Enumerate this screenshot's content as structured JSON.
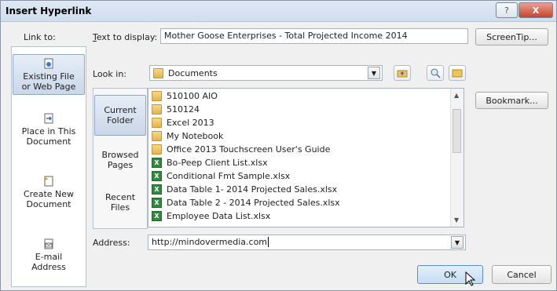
{
  "dialog": {
    "title": "Insert Hyperlink",
    "help_glyph": "?",
    "close_glyph": "X"
  },
  "link_to": {
    "label": "Link to:",
    "items": [
      {
        "line1": "Existing File",
        "line2": "or Web Page",
        "selected": true
      },
      {
        "line1": "Place in This",
        "line2": "Document"
      },
      {
        "line1": "Create New",
        "line2": "Document"
      },
      {
        "line1": "E-mail",
        "line2": "Address"
      }
    ]
  },
  "text_to_display": {
    "label": "Text to display:",
    "value": "Mother Goose Enterprises - Total Projected Income 2014"
  },
  "screentip_button": "ScreenTip...",
  "look_in": {
    "label": "Look in:",
    "value": "Documents"
  },
  "locations": [
    {
      "line1": "Current",
      "line2": "Folder",
      "selected": true
    },
    {
      "line1": "Browsed",
      "line2": "Pages"
    },
    {
      "line1": "Recent",
      "line2": "Files"
    }
  ],
  "files": [
    {
      "name": "510100 AIO",
      "type": "folder"
    },
    {
      "name": "510124",
      "type": "folder"
    },
    {
      "name": "Excel 2013",
      "type": "folder"
    },
    {
      "name": "My Notebook",
      "type": "folder"
    },
    {
      "name": "Office 2013 Touchscreen User's Guide",
      "type": "folder"
    },
    {
      "name": "Bo-Peep Client List.xlsx",
      "type": "excel"
    },
    {
      "name": "Conditional Fmt Sample.xlsx",
      "type": "excel"
    },
    {
      "name": "Data Table 1- 2014 Projected Sales.xlsx",
      "type": "excel"
    },
    {
      "name": "Data Table 2 - 2014 Projected Sales.xlsx",
      "type": "excel"
    },
    {
      "name": "Employee Data List.xlsx",
      "type": "excel"
    }
  ],
  "bookmark_button": "Bookmark...",
  "address": {
    "label": "Address:",
    "value": "http://mindovermedia.com"
  },
  "ok_button": "OK",
  "cancel_button": "Cancel",
  "colors": {
    "title_bar": "#dfe9f5",
    "close_button": "#c7432c",
    "ok_highlight": "#cfe3f7"
  }
}
